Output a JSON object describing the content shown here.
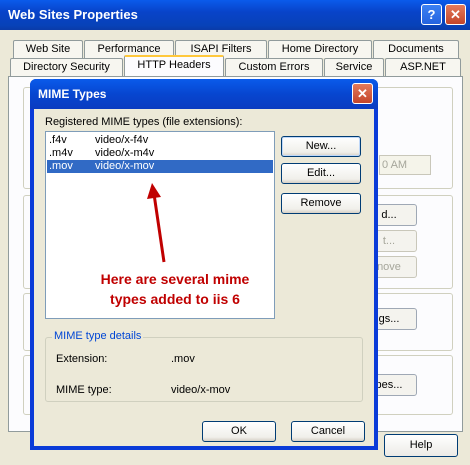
{
  "window": {
    "title": "Web Sites Properties",
    "help_glyph": "?",
    "close_glyph": "✕"
  },
  "tabs_row1": [
    "Web Site",
    "Performance",
    "ISAPI Filters",
    "Home Directory",
    "Documents"
  ],
  "tabs_row2": [
    "Directory Security",
    "HTTP Headers",
    "Custom Errors",
    "Service",
    "ASP.NET"
  ],
  "active_tab": "HTTP Headers",
  "background": {
    "time_field": "0 AM",
    "buttons": [
      "d...",
      "t...",
      "nove",
      "gs...",
      "pes..."
    ]
  },
  "help_button": "Help",
  "dialog": {
    "title": "MIME Types",
    "close_glyph": "✕",
    "list_label": "Registered MIME types (file extensions):",
    "mime_types": [
      {
        "ext": ".f4v",
        "type": "video/x-f4v"
      },
      {
        "ext": ".m4v",
        "type": "video/x-m4v"
      },
      {
        "ext": ".mov",
        "type": "video/x-mov"
      }
    ],
    "selected_index": 2,
    "buttons": {
      "new": "New...",
      "edit": "Edit...",
      "remove": "Remove"
    },
    "details": {
      "legend": "MIME type details",
      "extension_label": "Extension:",
      "extension_value": ".mov",
      "type_label": "MIME type:",
      "type_value": "video/x-mov"
    },
    "ok": "OK",
    "cancel": "Cancel"
  },
  "annotation": {
    "line1": "Here are several mime",
    "line2": "types added to iis 6",
    "color": "#C00000"
  }
}
